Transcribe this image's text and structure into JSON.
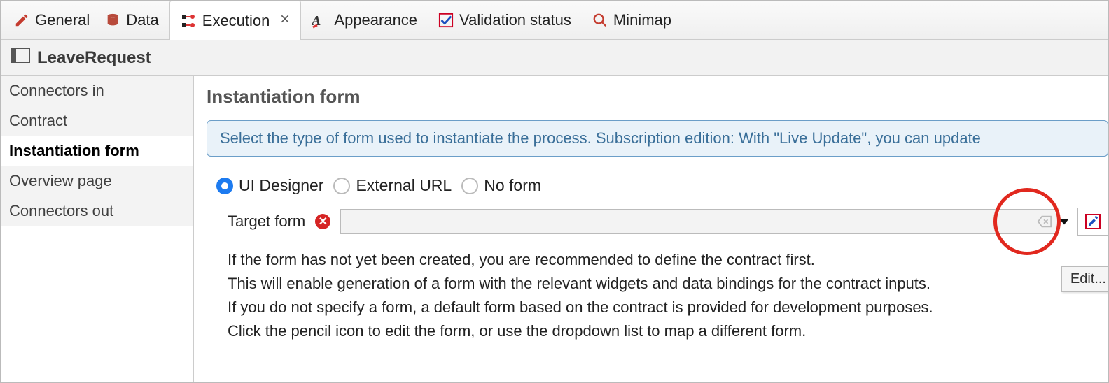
{
  "tabs": {
    "general": "General",
    "data": "Data",
    "execution": "Execution",
    "appearance": "Appearance",
    "validation": "Validation status",
    "minimap": "Minimap"
  },
  "subheader": {
    "title": "LeaveRequest"
  },
  "sidebar": {
    "items": [
      {
        "label": "Connectors in"
      },
      {
        "label": "Contract"
      },
      {
        "label": "Instantiation form"
      },
      {
        "label": "Overview page"
      },
      {
        "label": "Connectors out"
      }
    ],
    "active_index": 2
  },
  "main": {
    "heading": "Instantiation form",
    "info": "Select the type of form used to instantiate the process. Subscription edition: With \"Live Update\", you can update",
    "radios": {
      "ui_designer": "UI Designer",
      "external_url": "External URL",
      "no_form": "No form",
      "selected": "ui_designer"
    },
    "target_form": {
      "label": "Target form",
      "value": "",
      "placeholder": ""
    },
    "tooltip": "Edit...",
    "help_lines": [
      "If the form has not yet been created, you are recommended to define the contract first.",
      "This will enable generation of a form with the relevant widgets and data bindings for the contract inputs.",
      "If you do not specify a form, a default form based on the contract is provided for development purposes.",
      "Click the pencil icon to edit the form, or use the dropdown list to map a different form."
    ]
  },
  "colors": {
    "accent": "#1d7bf0",
    "error": "#d62424",
    "highlight": "#e1281e",
    "info_border": "#6b9ec8"
  }
}
